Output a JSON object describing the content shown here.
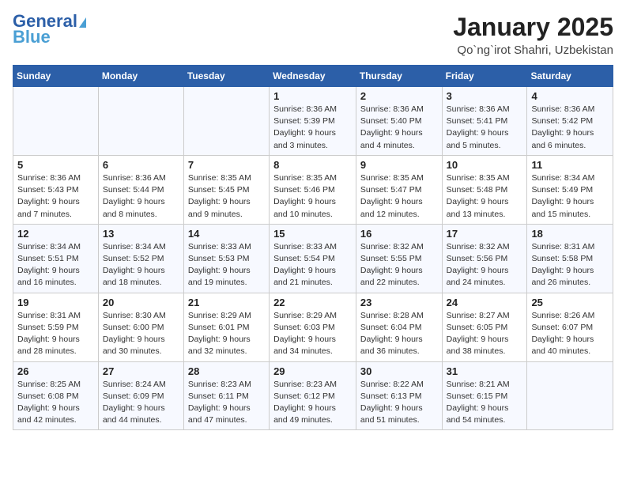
{
  "logo": {
    "line1": "General",
    "line2": "Blue"
  },
  "title": "January 2025",
  "subtitle": "Qo`ng`irot Shahri, Uzbekistan",
  "header": {
    "accent_color": "#2c5fa8"
  },
  "weekdays": [
    "Sunday",
    "Monday",
    "Tuesday",
    "Wednesday",
    "Thursday",
    "Friday",
    "Saturday"
  ],
  "weeks": [
    [
      {
        "day": "",
        "sunrise": "",
        "sunset": "",
        "daylight": ""
      },
      {
        "day": "",
        "sunrise": "",
        "sunset": "",
        "daylight": ""
      },
      {
        "day": "",
        "sunrise": "",
        "sunset": "",
        "daylight": ""
      },
      {
        "day": "1",
        "sunrise": "Sunrise: 8:36 AM",
        "sunset": "Sunset: 5:39 PM",
        "daylight": "Daylight: 9 hours and 3 minutes."
      },
      {
        "day": "2",
        "sunrise": "Sunrise: 8:36 AM",
        "sunset": "Sunset: 5:40 PM",
        "daylight": "Daylight: 9 hours and 4 minutes."
      },
      {
        "day": "3",
        "sunrise": "Sunrise: 8:36 AM",
        "sunset": "Sunset: 5:41 PM",
        "daylight": "Daylight: 9 hours and 5 minutes."
      },
      {
        "day": "4",
        "sunrise": "Sunrise: 8:36 AM",
        "sunset": "Sunset: 5:42 PM",
        "daylight": "Daylight: 9 hours and 6 minutes."
      }
    ],
    [
      {
        "day": "5",
        "sunrise": "Sunrise: 8:36 AM",
        "sunset": "Sunset: 5:43 PM",
        "daylight": "Daylight: 9 hours and 7 minutes."
      },
      {
        "day": "6",
        "sunrise": "Sunrise: 8:36 AM",
        "sunset": "Sunset: 5:44 PM",
        "daylight": "Daylight: 9 hours and 8 minutes."
      },
      {
        "day": "7",
        "sunrise": "Sunrise: 8:35 AM",
        "sunset": "Sunset: 5:45 PM",
        "daylight": "Daylight: 9 hours and 9 minutes."
      },
      {
        "day": "8",
        "sunrise": "Sunrise: 8:35 AM",
        "sunset": "Sunset: 5:46 PM",
        "daylight": "Daylight: 9 hours and 10 minutes."
      },
      {
        "day": "9",
        "sunrise": "Sunrise: 8:35 AM",
        "sunset": "Sunset: 5:47 PM",
        "daylight": "Daylight: 9 hours and 12 minutes."
      },
      {
        "day": "10",
        "sunrise": "Sunrise: 8:35 AM",
        "sunset": "Sunset: 5:48 PM",
        "daylight": "Daylight: 9 hours and 13 minutes."
      },
      {
        "day": "11",
        "sunrise": "Sunrise: 8:34 AM",
        "sunset": "Sunset: 5:49 PM",
        "daylight": "Daylight: 9 hours and 15 minutes."
      }
    ],
    [
      {
        "day": "12",
        "sunrise": "Sunrise: 8:34 AM",
        "sunset": "Sunset: 5:51 PM",
        "daylight": "Daylight: 9 hours and 16 minutes."
      },
      {
        "day": "13",
        "sunrise": "Sunrise: 8:34 AM",
        "sunset": "Sunset: 5:52 PM",
        "daylight": "Daylight: 9 hours and 18 minutes."
      },
      {
        "day": "14",
        "sunrise": "Sunrise: 8:33 AM",
        "sunset": "Sunset: 5:53 PM",
        "daylight": "Daylight: 9 hours and 19 minutes."
      },
      {
        "day": "15",
        "sunrise": "Sunrise: 8:33 AM",
        "sunset": "Sunset: 5:54 PM",
        "daylight": "Daylight: 9 hours and 21 minutes."
      },
      {
        "day": "16",
        "sunrise": "Sunrise: 8:32 AM",
        "sunset": "Sunset: 5:55 PM",
        "daylight": "Daylight: 9 hours and 22 minutes."
      },
      {
        "day": "17",
        "sunrise": "Sunrise: 8:32 AM",
        "sunset": "Sunset: 5:56 PM",
        "daylight": "Daylight: 9 hours and 24 minutes."
      },
      {
        "day": "18",
        "sunrise": "Sunrise: 8:31 AM",
        "sunset": "Sunset: 5:58 PM",
        "daylight": "Daylight: 9 hours and 26 minutes."
      }
    ],
    [
      {
        "day": "19",
        "sunrise": "Sunrise: 8:31 AM",
        "sunset": "Sunset: 5:59 PM",
        "daylight": "Daylight: 9 hours and 28 minutes."
      },
      {
        "day": "20",
        "sunrise": "Sunrise: 8:30 AM",
        "sunset": "Sunset: 6:00 PM",
        "daylight": "Daylight: 9 hours and 30 minutes."
      },
      {
        "day": "21",
        "sunrise": "Sunrise: 8:29 AM",
        "sunset": "Sunset: 6:01 PM",
        "daylight": "Daylight: 9 hours and 32 minutes."
      },
      {
        "day": "22",
        "sunrise": "Sunrise: 8:29 AM",
        "sunset": "Sunset: 6:03 PM",
        "daylight": "Daylight: 9 hours and 34 minutes."
      },
      {
        "day": "23",
        "sunrise": "Sunrise: 8:28 AM",
        "sunset": "Sunset: 6:04 PM",
        "daylight": "Daylight: 9 hours and 36 minutes."
      },
      {
        "day": "24",
        "sunrise": "Sunrise: 8:27 AM",
        "sunset": "Sunset: 6:05 PM",
        "daylight": "Daylight: 9 hours and 38 minutes."
      },
      {
        "day": "25",
        "sunrise": "Sunrise: 8:26 AM",
        "sunset": "Sunset: 6:07 PM",
        "daylight": "Daylight: 9 hours and 40 minutes."
      }
    ],
    [
      {
        "day": "26",
        "sunrise": "Sunrise: 8:25 AM",
        "sunset": "Sunset: 6:08 PM",
        "daylight": "Daylight: 9 hours and 42 minutes."
      },
      {
        "day": "27",
        "sunrise": "Sunrise: 8:24 AM",
        "sunset": "Sunset: 6:09 PM",
        "daylight": "Daylight: 9 hours and 44 minutes."
      },
      {
        "day": "28",
        "sunrise": "Sunrise: 8:23 AM",
        "sunset": "Sunset: 6:11 PM",
        "daylight": "Daylight: 9 hours and 47 minutes."
      },
      {
        "day": "29",
        "sunrise": "Sunrise: 8:23 AM",
        "sunset": "Sunset: 6:12 PM",
        "daylight": "Daylight: 9 hours and 49 minutes."
      },
      {
        "day": "30",
        "sunrise": "Sunrise: 8:22 AM",
        "sunset": "Sunset: 6:13 PM",
        "daylight": "Daylight: 9 hours and 51 minutes."
      },
      {
        "day": "31",
        "sunrise": "Sunrise: 8:21 AM",
        "sunset": "Sunset: 6:15 PM",
        "daylight": "Daylight: 9 hours and 54 minutes."
      },
      {
        "day": "",
        "sunrise": "",
        "sunset": "",
        "daylight": ""
      }
    ]
  ]
}
